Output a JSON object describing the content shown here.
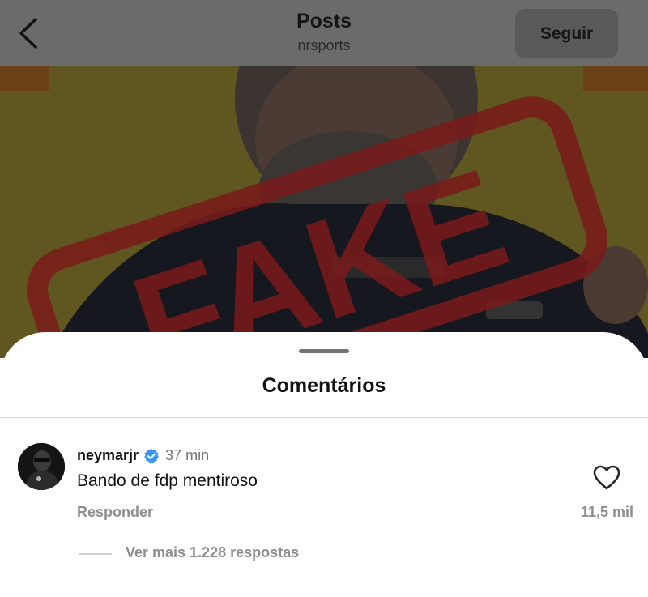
{
  "header": {
    "title": "Posts",
    "subtitle": "nrsports",
    "follow_label": "Seguir"
  },
  "post": {
    "stamp_text": "FAKE",
    "background_color": "#e0c92b",
    "stamp_color": "#c8202a"
  },
  "comments": {
    "title": "Comentários",
    "items": [
      {
        "username": "neymarjr",
        "verified": true,
        "time": "37 min",
        "text": "Bando de fdp mentiroso",
        "reply_label": "Responder",
        "likes": "11,5 mil",
        "more_replies": "Ver mais 1.228 respostas"
      }
    ]
  },
  "colors": {
    "verified_badge": "#3897f0",
    "secondary_text": "#8e8e8e"
  },
  "icons": {
    "back": "chevron-left-icon",
    "like": "heart-outline-icon",
    "verified": "verified-badge-icon"
  }
}
